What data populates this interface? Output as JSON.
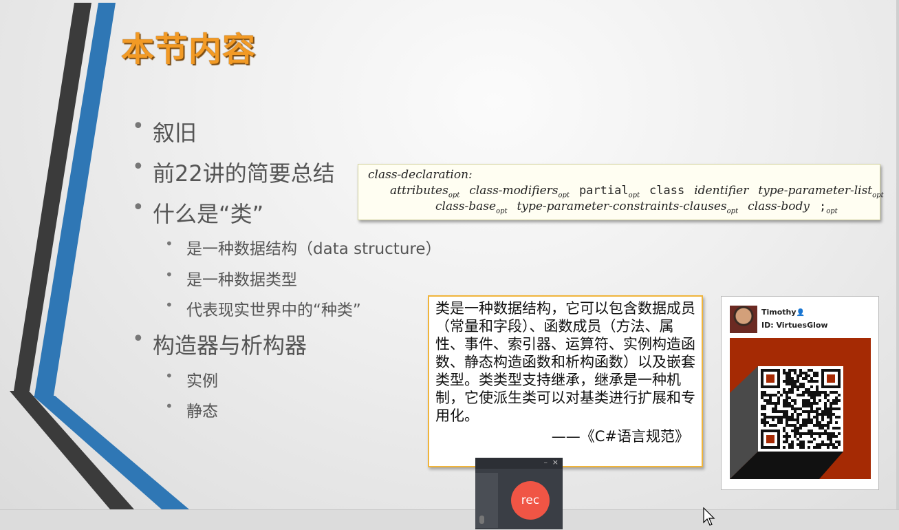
{
  "slide": {
    "title": "本节内容",
    "bullets": [
      {
        "text": "叙旧",
        "level": 1
      },
      {
        "text": "前22讲的简要总结",
        "level": 1
      },
      {
        "text": "什么是“类”",
        "level": 1
      },
      {
        "text": "是一种数据结构（data structure）",
        "level": 2
      },
      {
        "text": "是一种数据类型",
        "level": 2
      },
      {
        "text": "代表现实世界中的“种类”",
        "level": 2
      },
      {
        "text": "构造器与析构器",
        "level": 1
      },
      {
        "text": "实例",
        "level": 2
      },
      {
        "text": "静态",
        "level": 2
      }
    ],
    "grammar": {
      "head": "class-declaration:",
      "attributes": "attributes",
      "class_modifiers": "class-modifiers",
      "partial": "partial",
      "class_kw": "class",
      "identifier": "identifier",
      "type_parameter_list": "type-parameter-list",
      "class_base": "class-base",
      "type_parameter_constraints": "type-parameter-constraints-clauses",
      "class_body": "class-body",
      "semicolon": ";",
      "opt": "opt"
    },
    "quote": {
      "text": "类是一种数据结构，它可以包含数据成员（常量和字段）、函数成员（方法、属性、事件、索引器、运算符、实例构造函数、静态构造函数和析构函数）以及嵌套类型。类类型支持继承，继承是一种机制，它使派生类可以对基类进行扩展和专用化。",
      "source": "——《C#语言规范》"
    }
  },
  "profile_card": {
    "name": "Timothy",
    "id": "ID: VirtuesGlow",
    "icons": [
      "avatar",
      "person-icon",
      "qr-code"
    ]
  },
  "recorder": {
    "rec_label": "rec",
    "min_glyph": "–",
    "close_glyph": "×"
  },
  "colors": {
    "title": "#f29a25",
    "stripe_blue": "#2f77b5",
    "stripe_dark": "#3a3a3a",
    "quote_border": "#f0b43a",
    "rec_button": "#f05545",
    "qr_background": "#a52a04"
  }
}
